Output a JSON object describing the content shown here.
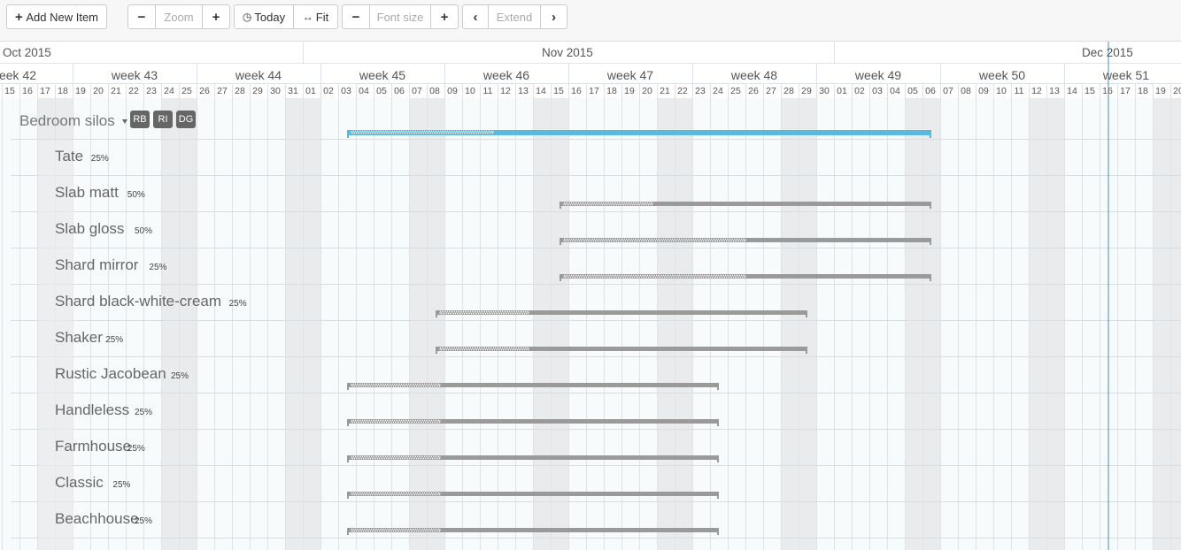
{
  "toolbar": {
    "add_label": "Add New Item",
    "zoom_placeholder": "Zoom",
    "today_label": "Today",
    "fit_label": "Fit",
    "font_placeholder": "Font size",
    "extend_placeholder": "Extend"
  },
  "timeline": {
    "months": [
      {
        "label": "Oct 2015",
        "day_index": 0
      },
      {
        "label": "Nov 2015",
        "day_index": 17
      },
      {
        "label": "Dec 2015",
        "day_index": 47
      }
    ],
    "weeks": [
      "eek 42",
      "week 43",
      "week 44",
      "week 45",
      "week 46",
      "week 47",
      "week 48",
      "week 49",
      "week 50",
      "week 51"
    ],
    "days": [
      "15",
      "16",
      "17",
      "18",
      "19",
      "20",
      "21",
      "22",
      "23",
      "24",
      "25",
      "26",
      "27",
      "28",
      "29",
      "30",
      "31",
      "01",
      "02",
      "03",
      "04",
      "05",
      "06",
      "07",
      "08",
      "09",
      "10",
      "11",
      "12",
      "13",
      "14",
      "15",
      "16",
      "17",
      "18",
      "19",
      "20",
      "21",
      "22",
      "23",
      "24",
      "25",
      "26",
      "27",
      "28",
      "29",
      "30",
      "01",
      "02",
      "03",
      "04",
      "05",
      "06",
      "07",
      "08",
      "09",
      "10",
      "11",
      "12",
      "13",
      "14",
      "15",
      "16",
      "17",
      "18",
      "19",
      "20"
    ],
    "weekend_day_indices": [
      2,
      3,
      9,
      10,
      16,
      17,
      23,
      24,
      30,
      31,
      37,
      38,
      44,
      45,
      51,
      52,
      58,
      59,
      65,
      66
    ],
    "today_day_index": 62.5
  },
  "tasks": [
    {
      "name": "Bedroom silos",
      "parent": true,
      "percent": "",
      "start": 19.5,
      "end": 52.5,
      "progress": 0.25,
      "owners": [
        "RB",
        "RI",
        "DG"
      ]
    },
    {
      "name": "Tate",
      "percent": "25%",
      "start": 31.5,
      "end": 52.5,
      "progress": 0.25
    },
    {
      "name": "Slab matt",
      "percent": "50%",
      "start": 31.5,
      "end": 52.5,
      "progress": 0.5
    },
    {
      "name": "Slab gloss",
      "percent": "50%",
      "start": 31.5,
      "end": 52.5,
      "progress": 0.5
    },
    {
      "name": "Shard mirror",
      "percent": "25%",
      "start": 24.5,
      "end": 45.5,
      "progress": 0.25
    },
    {
      "name": "Shard black-white-cream",
      "percent": "25%",
      "start": 24.5,
      "end": 45.5,
      "progress": 0.25
    },
    {
      "name": "Shaker",
      "percent": "25%",
      "start": 19.5,
      "end": 40.5,
      "progress": 0.25
    },
    {
      "name": "Rustic Jacobean",
      "percent": "25%",
      "start": 19.5,
      "end": 40.5,
      "progress": 0.25
    },
    {
      "name": "Handleless",
      "percent": "25%",
      "start": 19.5,
      "end": 40.5,
      "progress": 0.25
    },
    {
      "name": "Farmhouse",
      "percent": "25%",
      "start": 19.5,
      "end": 40.5,
      "progress": 0.25
    },
    {
      "name": "Classic",
      "percent": "25%",
      "start": 19.5,
      "end": 40.5,
      "progress": 0.25
    },
    {
      "name": "Beachhouse",
      "percent": "25%",
      "start": 19.5,
      "end": 40.5,
      "progress": 0.25
    }
  ],
  "colors": {
    "parent_bar": "#5bb8de",
    "child_bar": "#9a9a9a",
    "weekend_bg": "#e9ebec",
    "today_line": "#4a90b8"
  }
}
